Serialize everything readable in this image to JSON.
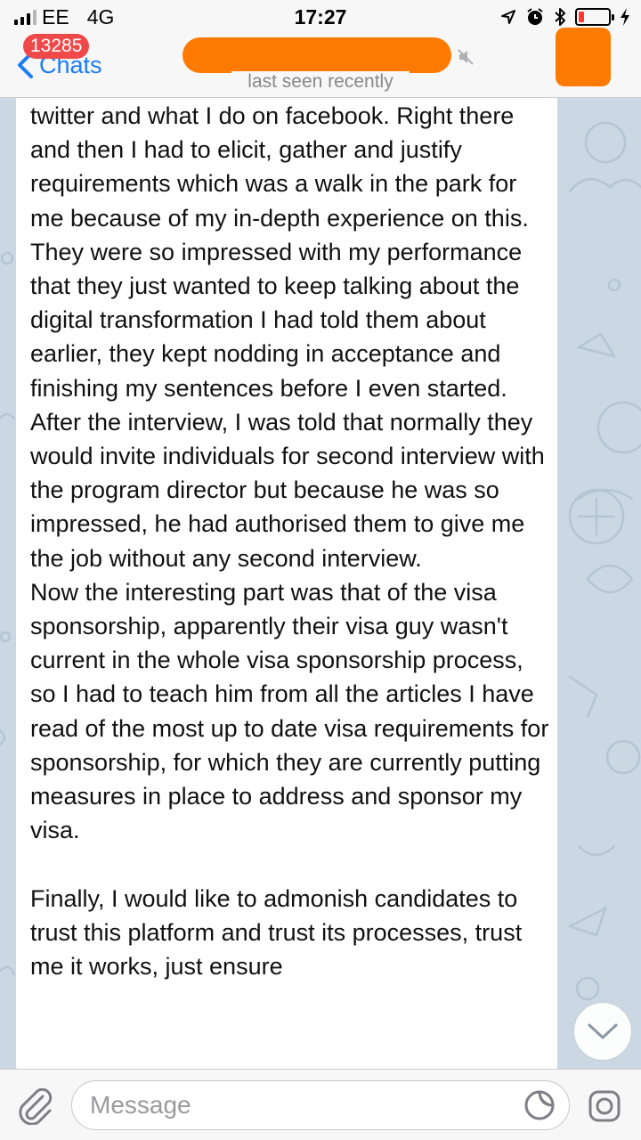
{
  "status_bar": {
    "carrier": "EE",
    "network": "4G",
    "time": "17:27"
  },
  "nav": {
    "back_label": "Chats",
    "unread_count": "13285",
    "last_seen": "last seen recently"
  },
  "message": {
    "text": "twitter and what I do on facebook. Right there and then I had to elicit, gather and justify requirements which was a walk in the park for me because of my in-depth experience on this. They were so impressed with my performance that they just wanted to keep talking about the digital transformation I had told them about earlier, they kept nodding in acceptance and finishing my sentences before I even started. After the interview, I was told that normally they would invite individuals for second interview with the program director but because he was so impressed, he had authorised them to give me the job without any second interview.\nNow the interesting part was that of the visa sponsorship, apparently their visa guy wasn't current in the whole visa sponsorship process, so I had to teach him from all the articles I have read of the most up to date visa requirements for sponsorship, for which they are currently putting measures in place to address and sponsor my visa.\n\nFinally, I would like to admonish candidates to trust this platform and trust its processes, trust me it works, just ensure"
  },
  "input": {
    "placeholder": "Message"
  },
  "colors": {
    "accent": "#1c7cf5",
    "badge": "#f0494a",
    "redaction": "#ff7a00",
    "battery_low": "#ff3b30",
    "wallpaper": "#cbd8e4"
  },
  "icons": [
    "signal-icon",
    "location-icon",
    "alarm-icon",
    "bluetooth-icon",
    "battery-icon",
    "charging-icon",
    "back-chevron-icon",
    "mute-icon",
    "chevron-down-icon",
    "paperclip-icon",
    "sticker-icon",
    "camera-icon"
  ]
}
